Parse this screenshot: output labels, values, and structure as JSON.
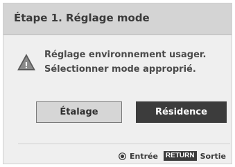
{
  "dialog": {
    "title": "Étape 1. Réglage mode",
    "message_line1": "Réglage environnement usager.",
    "message_line2": "Sélectionner mode approprié.",
    "warning_icon_glyph": "!"
  },
  "buttons": {
    "etalage_label": "Étalage",
    "residence_label": "Résidence",
    "selected": "Résidence"
  },
  "footer": {
    "ok_label": "Entrée",
    "return_key_label": "RETURN",
    "return_label": "Sortie"
  },
  "icons": {
    "warning": "warning-triangle-icon",
    "ok": "ok-circle-icon"
  },
  "colors": {
    "selected_button": "#3c3c3c",
    "unselected_button": "#d6d6d6",
    "header": "#d4d4d4",
    "dialog_background": "#efefef"
  }
}
